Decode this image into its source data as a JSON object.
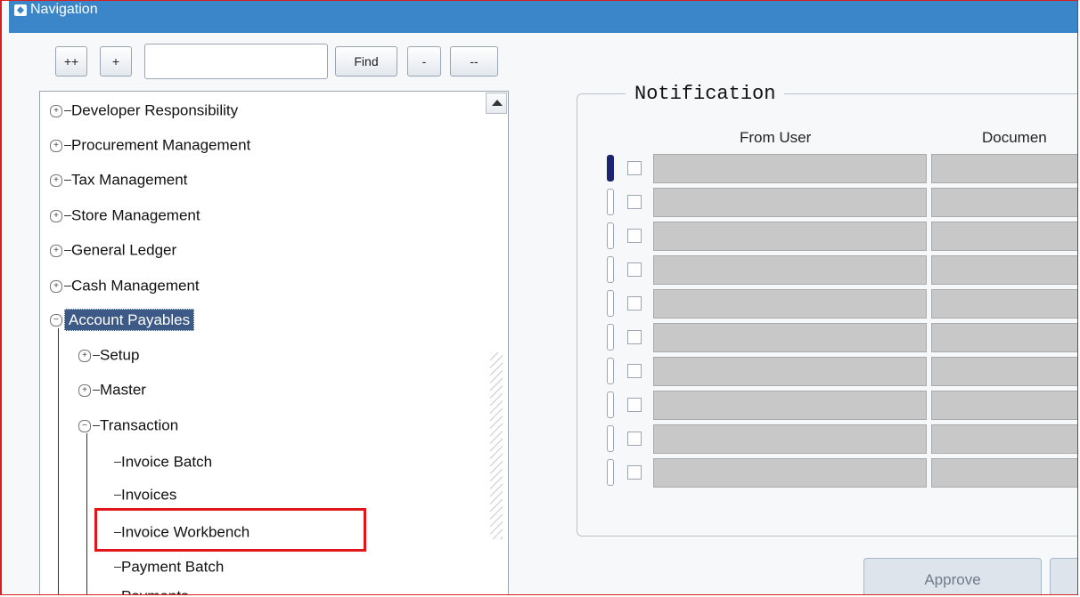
{
  "window": {
    "title": "Navigation"
  },
  "toolbar": {
    "expand_all_label": "++",
    "expand_label": "+",
    "find_label": "Find",
    "collapse_label": "-",
    "collapse_all_label": "--",
    "search_value": ""
  },
  "tree": {
    "items": [
      {
        "label": "Developer Responsibility",
        "expander": "+"
      },
      {
        "label": "Procurement Management",
        "expander": "+"
      },
      {
        "label": "Tax Management",
        "expander": "+"
      },
      {
        "label": "Store Management",
        "expander": "+"
      },
      {
        "label": "General Ledger",
        "expander": "+"
      },
      {
        "label": "Cash Management",
        "expander": "+"
      },
      {
        "label": "Account Payables",
        "expander": "−"
      },
      {
        "label": "Setup",
        "expander": "+"
      },
      {
        "label": "Master",
        "expander": "+"
      },
      {
        "label": "Transaction",
        "expander": "−"
      },
      {
        "label": "Invoice Batch"
      },
      {
        "label": "Invoices"
      },
      {
        "label": "Invoice Workbench"
      },
      {
        "label": "Payment Batch"
      },
      {
        "label": "Payments"
      }
    ]
  },
  "notification": {
    "title": "Notification",
    "col_from_user": "From User",
    "col_document": "Documen",
    "row_count": 10
  },
  "actions": {
    "approve_label": "Approve"
  },
  "colors": {
    "titlebar": "#3b86c8",
    "selected": "#3d5a86",
    "highlight": "#e0161b"
  }
}
